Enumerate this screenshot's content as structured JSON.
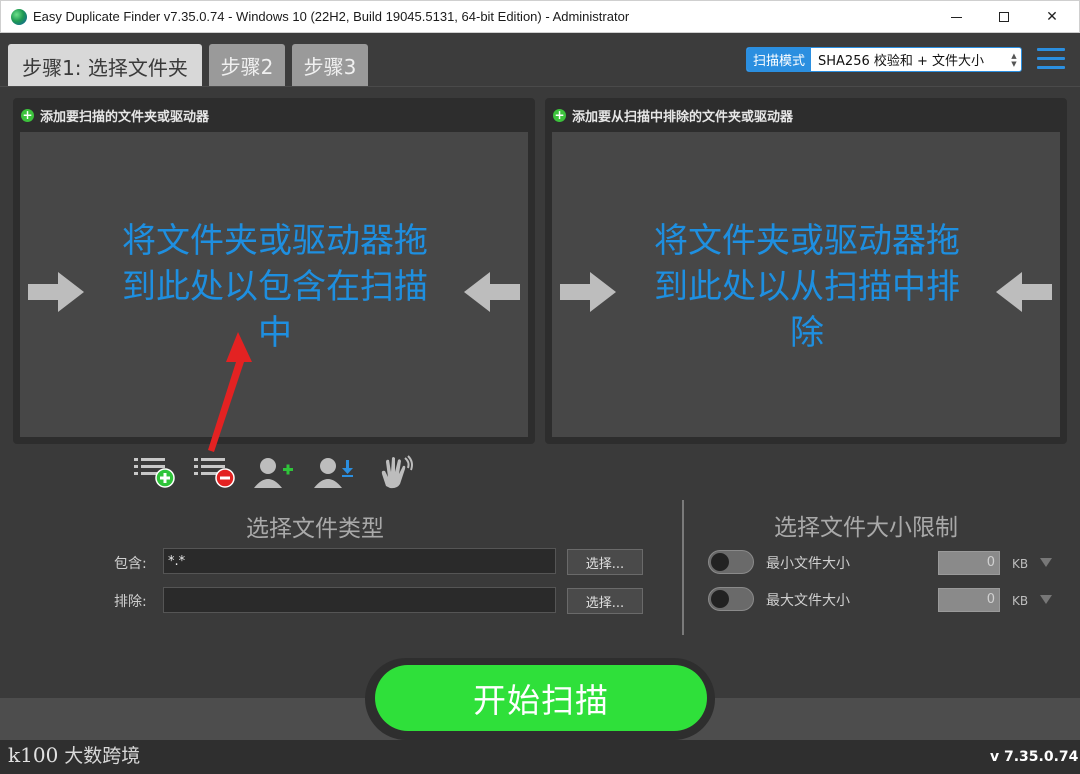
{
  "window": {
    "title": "Easy Duplicate Finder v7.35.0.74 - Windows 10 (22H2, Build 19045.5131, 64-bit Edition) - Administrator",
    "controls": {
      "minimize": "—",
      "maximize": "☐",
      "close": "✕"
    }
  },
  "tabs": [
    {
      "label": "步骤1: 选择文件夹",
      "active": true
    },
    {
      "label": "步骤2",
      "active": false
    },
    {
      "label": "步骤3",
      "active": false
    }
  ],
  "scan_mode": {
    "label": "扫描模式",
    "value": "SHA256 校验和 + 文件大小"
  },
  "include_panel": {
    "header": "添加要扫描的文件夹或驱动器",
    "drop_text": "将文件夹或驱动器拖到此处以包含在扫描中"
  },
  "exclude_panel": {
    "header": "添加要从扫描中排除的文件夹或驱动器",
    "drop_text": "将文件夹或驱动器拖到此处以从扫描中排除"
  },
  "file_types": {
    "title": "选择文件类型",
    "include_label": "包含:",
    "include_value": "*.*",
    "exclude_label": "排除:",
    "exclude_value": "",
    "select_label": "选择..."
  },
  "size_limits": {
    "title": "选择文件大小限制",
    "min_label": "最小文件大小",
    "min_value": "0",
    "max_label": "最大文件大小",
    "max_value": "0",
    "unit": "KB"
  },
  "start_button": "开始扫描",
  "watermark": {
    "logo": "k100",
    "text": "大数跨境"
  },
  "version": "v 7.35.0.74",
  "colors": {
    "accent": "#2b8fe0",
    "start": "#2fe03a",
    "annotation": "#e32222"
  }
}
